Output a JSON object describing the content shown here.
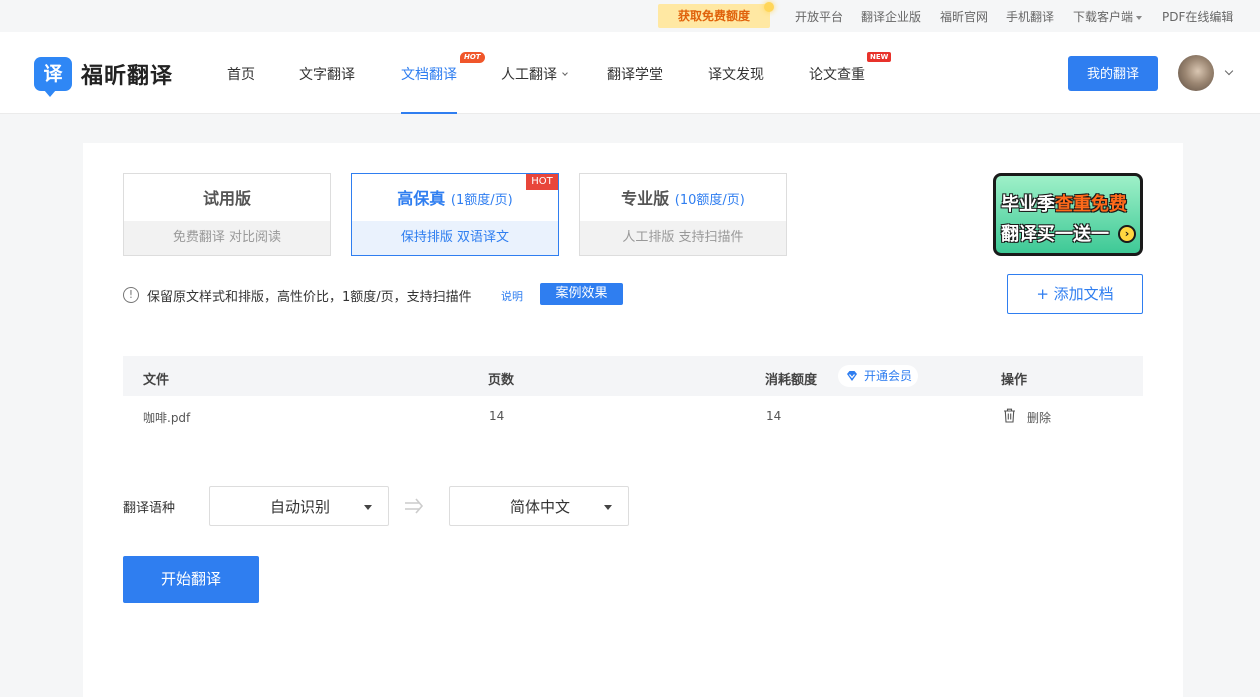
{
  "topbar": {
    "promo": "获取免费额度",
    "links": [
      "开放平台",
      "翻译企业版",
      "福昕官网",
      "手机翻译",
      "下载客户端",
      "PDF在线编辑"
    ]
  },
  "header": {
    "logo_char": "译",
    "logo_text": "福昕翻译",
    "nav": [
      "首页",
      "文字翻译",
      "文档翻译",
      "人工翻译",
      "翻译学堂",
      "译文发现",
      "论文查重"
    ],
    "active_nav": "文档翻译",
    "hot_badge": "HOT",
    "new_badge": "NEW",
    "my_translate": "我的翻译"
  },
  "plans": [
    {
      "title": "试用版",
      "sub": "",
      "features": "免费翻译  对比阅读"
    },
    {
      "title": "高保真",
      "sub": "(1额度/页)",
      "features": "保持排版  双语译文",
      "badge": "HOT"
    },
    {
      "title": "专业版",
      "sub": "(10额度/页)",
      "features": "人工排版  支持扫描件"
    }
  ],
  "banner": {
    "line1_a": "毕业季",
    "line1_b": "查重免费",
    "line2": "翻译买一送一"
  },
  "info": {
    "icon": "!",
    "text": "保留原文样式和排版，高性价比，1额度/页，支持扫描件",
    "link": "说明",
    "example_button": "案例效果"
  },
  "add_doc_button": "+ 添加文档",
  "table": {
    "headers": {
      "file": "文件",
      "pages": "页数",
      "credits": "消耗额度",
      "action": "操作"
    },
    "vip_link": "开通会员",
    "rows": [
      {
        "file": "咖啡.pdf",
        "pages": "14",
        "credits": "14",
        "action": "删除"
      }
    ]
  },
  "language": {
    "label": "翻译语种",
    "source": "自动识别",
    "target": "简体中文"
  },
  "start_button": "开始翻译",
  "colors": {
    "accent": "#2f7ef0",
    "hot": "#e8463a"
  }
}
